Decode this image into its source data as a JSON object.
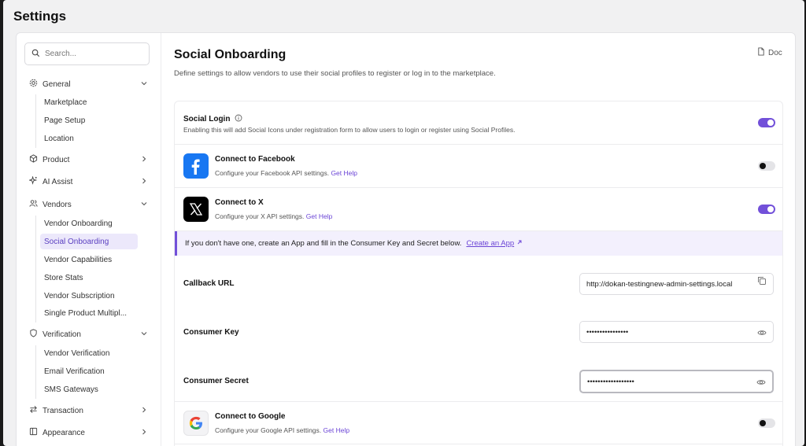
{
  "page": {
    "title": "Settings"
  },
  "search": {
    "placeholder": "Search..."
  },
  "sidebar": {
    "general": {
      "label": "General",
      "items": [
        "Marketplace",
        "Page Setup",
        "Location"
      ]
    },
    "product": {
      "label": "Product"
    },
    "ai_assist": {
      "label": "AI Assist"
    },
    "vendors": {
      "label": "Vendors",
      "items": [
        "Vendor Onboarding",
        "Social Onboarding",
        "Vendor Capabilities",
        "Store Stats",
        "Vendor Subscription",
        "Single Product Multipl..."
      ]
    },
    "verification": {
      "label": "Verification",
      "items": [
        "Vendor Verification",
        "Email Verification",
        "SMS Gateways"
      ]
    },
    "transaction": {
      "label": "Transaction"
    },
    "appearance": {
      "label": "Appearance"
    }
  },
  "main": {
    "title": "Social Onboarding",
    "description": "Define settings to allow vendors to use their social profiles to register or log in to the marketplace.",
    "doc_label": "Doc"
  },
  "social_login": {
    "title": "Social Login",
    "description": "Enabling this will add Social Icons under registration form to allow users to login or register using Social Profiles.",
    "enabled": true
  },
  "facebook": {
    "title": "Connect to Facebook",
    "description": "Configure your Facebook API settings.",
    "help": "Get Help",
    "enabled": false
  },
  "x": {
    "title": "Connect to X",
    "description": "Configure your X API settings.",
    "help": "Get Help",
    "enabled": true
  },
  "banner": {
    "text": "If you don't have one, create an App and fill in the Consumer Key and Secret below.",
    "link": "Create an App"
  },
  "fields": {
    "callback_label": "Callback URL",
    "callback_value": "http://dokan-testingnew-admin-settings.local",
    "key_label": "Consumer Key",
    "key_value": "••••••••••••••••",
    "secret_label": "Consumer Secret",
    "secret_value": "••••••••••••••••••"
  },
  "google": {
    "title": "Connect to Google",
    "description": "Configure your Google API settings.",
    "help": "Get Help",
    "enabled": false
  },
  "colors": {
    "accent": "#7250d9",
    "facebook": "#1877f2",
    "x": "#000000"
  }
}
